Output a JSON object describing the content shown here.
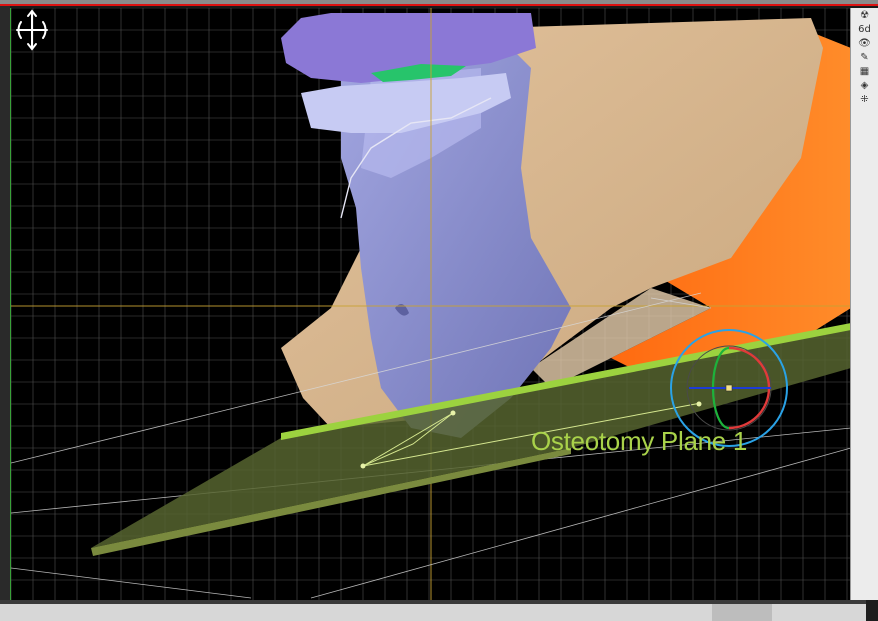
{
  "viewport": {
    "plane_label": "Osteotomy Plane 1"
  },
  "toolbar": {
    "tools": [
      {
        "name": "radiation-tool-icon",
        "glyph": "☢"
      },
      {
        "name": "zoom-tool-icon",
        "glyph": "6d"
      },
      {
        "name": "view-tool-icon",
        "glyph": "👁"
      },
      {
        "name": "paint-tool-icon",
        "glyph": "✎"
      },
      {
        "name": "layer-tool-icon",
        "glyph": "▦"
      },
      {
        "name": "object-tool-icon",
        "glyph": "◈"
      },
      {
        "name": "axis-tool-icon",
        "glyph": "⁜"
      }
    ]
  },
  "colors": {
    "plane": "#56642f",
    "plane_edge": "#9cd23f",
    "label": "#a9d24a",
    "grid": "#6e6e6e",
    "crosshair": "#c9a233",
    "soft_tissue": "#d7b58d",
    "bone_blue": "#8d92d0",
    "teeth_purple": "#8b78d6",
    "gum_green": "#27c46b",
    "orange": "#ff7a1a"
  }
}
